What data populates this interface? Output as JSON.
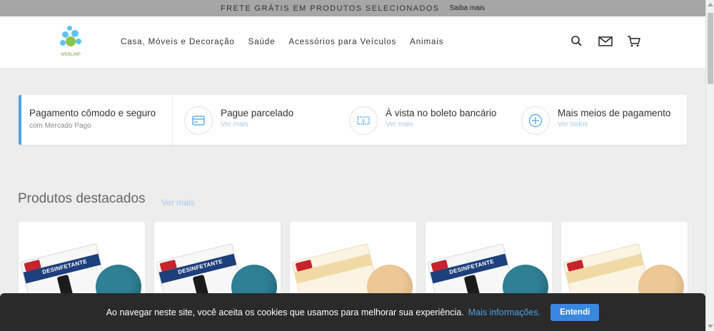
{
  "topbar": {
    "message": "FRETE GRÁTIS EM PRODUTOS SELECIONADOS",
    "link": "Saiba mais"
  },
  "header": {
    "logo_text": "WEBLIMP",
    "nav": [
      "Casa, Móveis e Decoração",
      "Saúde",
      "Acessórios para Veículos",
      "Animais"
    ],
    "icons": [
      "search-icon",
      "mail-icon",
      "cart-icon"
    ]
  },
  "payments": {
    "intro_title": "Pagamento cômodo e seguro",
    "intro_subtitle": "com Mercado Pago",
    "options": [
      {
        "title": "Pague parcelado",
        "link": "Ver mais",
        "icon": "credit-card-icon"
      },
      {
        "title": "À vista no boleto bancário",
        "link": "Ver mais",
        "icon": "cash-icon"
      },
      {
        "title": "Mais meios de pagamento",
        "link": "Ver todos",
        "icon": "plus-icon"
      }
    ]
  },
  "products": {
    "title": "Produtos destacados",
    "link": "Ver mais",
    "items": [
      {
        "pack_label": "DESINFETANTE",
        "disk_color": "blue"
      },
      {
        "pack_label": "DESINFETANTE",
        "disk_color": "blue"
      },
      {
        "pack_label": "",
        "disk_color": "beige"
      },
      {
        "pack_label": "DESINFETANTE",
        "disk_color": "blue"
      },
      {
        "pack_label": "",
        "disk_color": "beige"
      }
    ]
  },
  "cookie": {
    "text": "Ao navegar neste site, você aceita os cookies que usamos para melhorar sua experiência.",
    "link": "Mais informações.",
    "button": "Entendi"
  },
  "colors": {
    "accent": "#4aa3e8",
    "topbar": "#a6a6a6",
    "cookie_bg": "#2a2a2a",
    "button": "#3a87e0"
  }
}
